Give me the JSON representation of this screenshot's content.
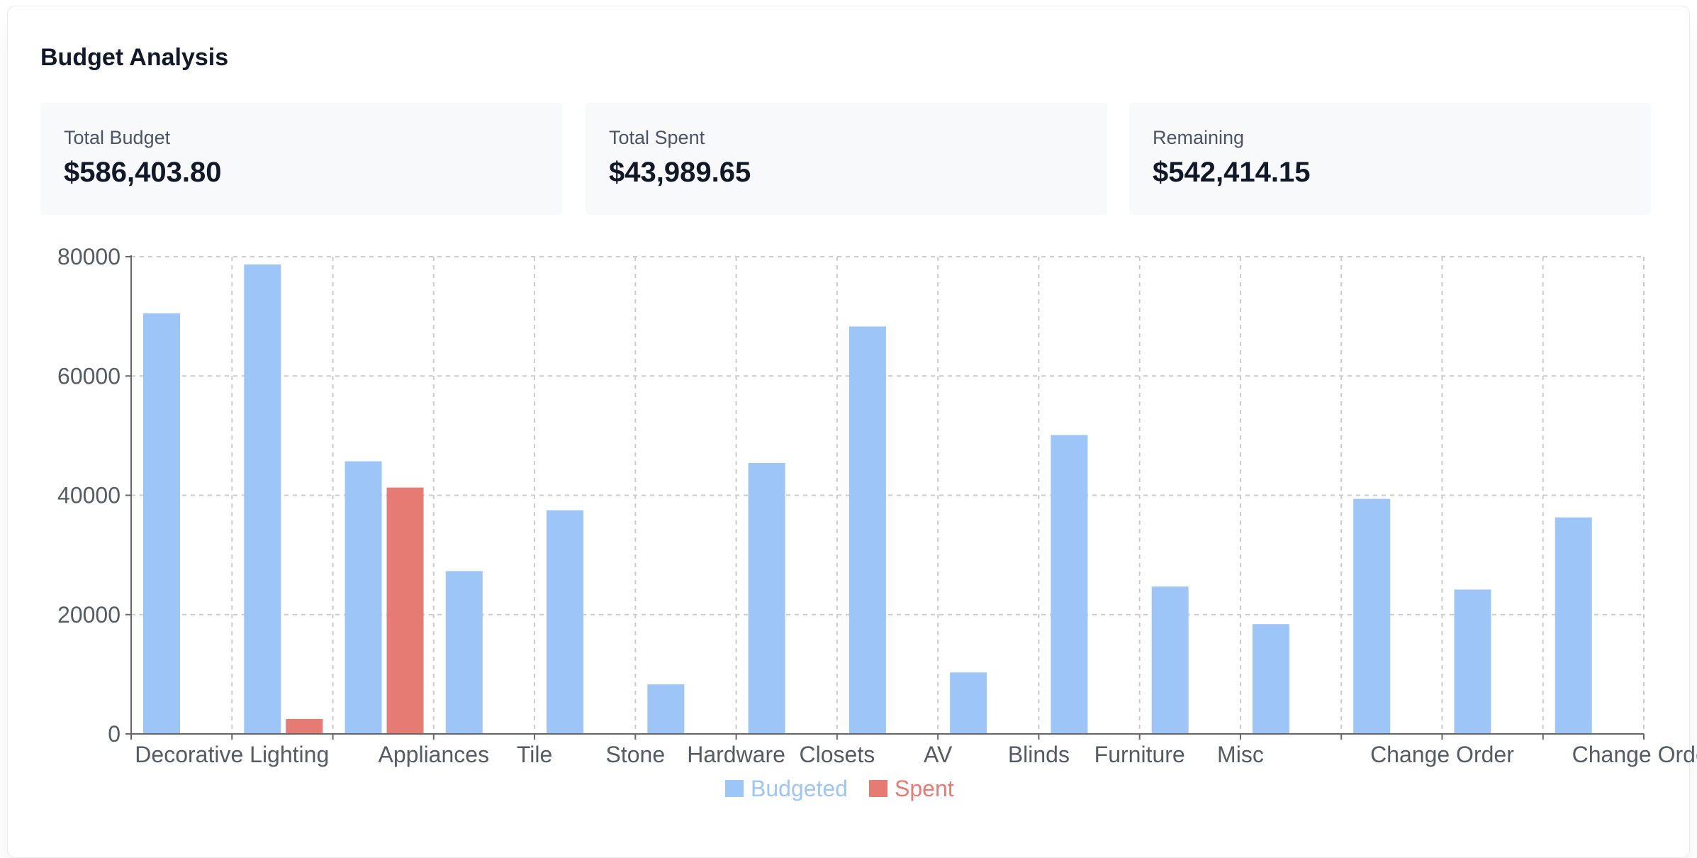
{
  "header": {
    "title": "Budget Analysis"
  },
  "stats": [
    {
      "label": "Total Budget",
      "value": "$586,403.80"
    },
    {
      "label": "Total Spent",
      "value": "$43,989.65"
    },
    {
      "label": "Remaining",
      "value": "$542,414.15"
    }
  ],
  "colors": {
    "budgeted": "#9ec5f8",
    "spent": "#e67b74",
    "grid": "#cccccc",
    "axis": "#666666"
  },
  "chart_data": {
    "type": "bar",
    "categories": [
      "",
      "Decorative Lighting",
      "",
      "Appliances",
      "Tile",
      "Stone",
      "Hardware",
      "Closets",
      "AV",
      "Blinds",
      "Furniture",
      "Misc",
      "",
      "Change Order",
      "",
      "Change Order"
    ],
    "visible_tick_labels": [
      "Decorative Lighting",
      "Appliances",
      "Tile",
      "Stone",
      "Hardware",
      "Closets",
      "AV",
      "Blinds",
      "Furniture",
      "Misc",
      "Change Order",
      "Change Order"
    ],
    "series": [
      {
        "name": "Budgeted",
        "values": [
          70500,
          78700,
          45700,
          27300,
          37500,
          8300,
          45400,
          68300,
          10300,
          50100,
          24700,
          18400,
          39400,
          24200,
          36300
        ]
      },
      {
        "name": "Spent",
        "values": [
          0,
          2500,
          41300,
          0,
          0,
          0,
          0,
          0,
          0,
          0,
          0,
          0,
          0,
          0,
          0
        ]
      }
    ],
    "ylim": [
      0,
      80000
    ],
    "yticks": [
      0,
      20000,
      40000,
      60000,
      80000
    ],
    "grid": true,
    "legend": "bottom-center"
  }
}
